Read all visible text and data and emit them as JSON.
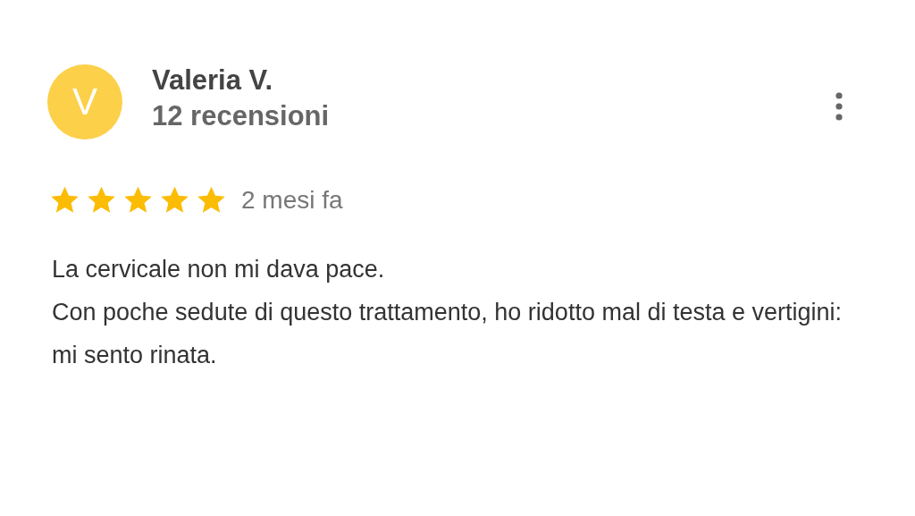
{
  "reviewer": {
    "initial": "V",
    "name": "Valeria V.",
    "review_count": "12 recensioni"
  },
  "rating": {
    "stars": 5,
    "date": "2 mesi fa"
  },
  "text": [
    "La cervicale non mi dava pace.",
    "Con poche sedute di questo trattamento, ho ridotto mal di testa e vertigini: mi sento rinata."
  ]
}
